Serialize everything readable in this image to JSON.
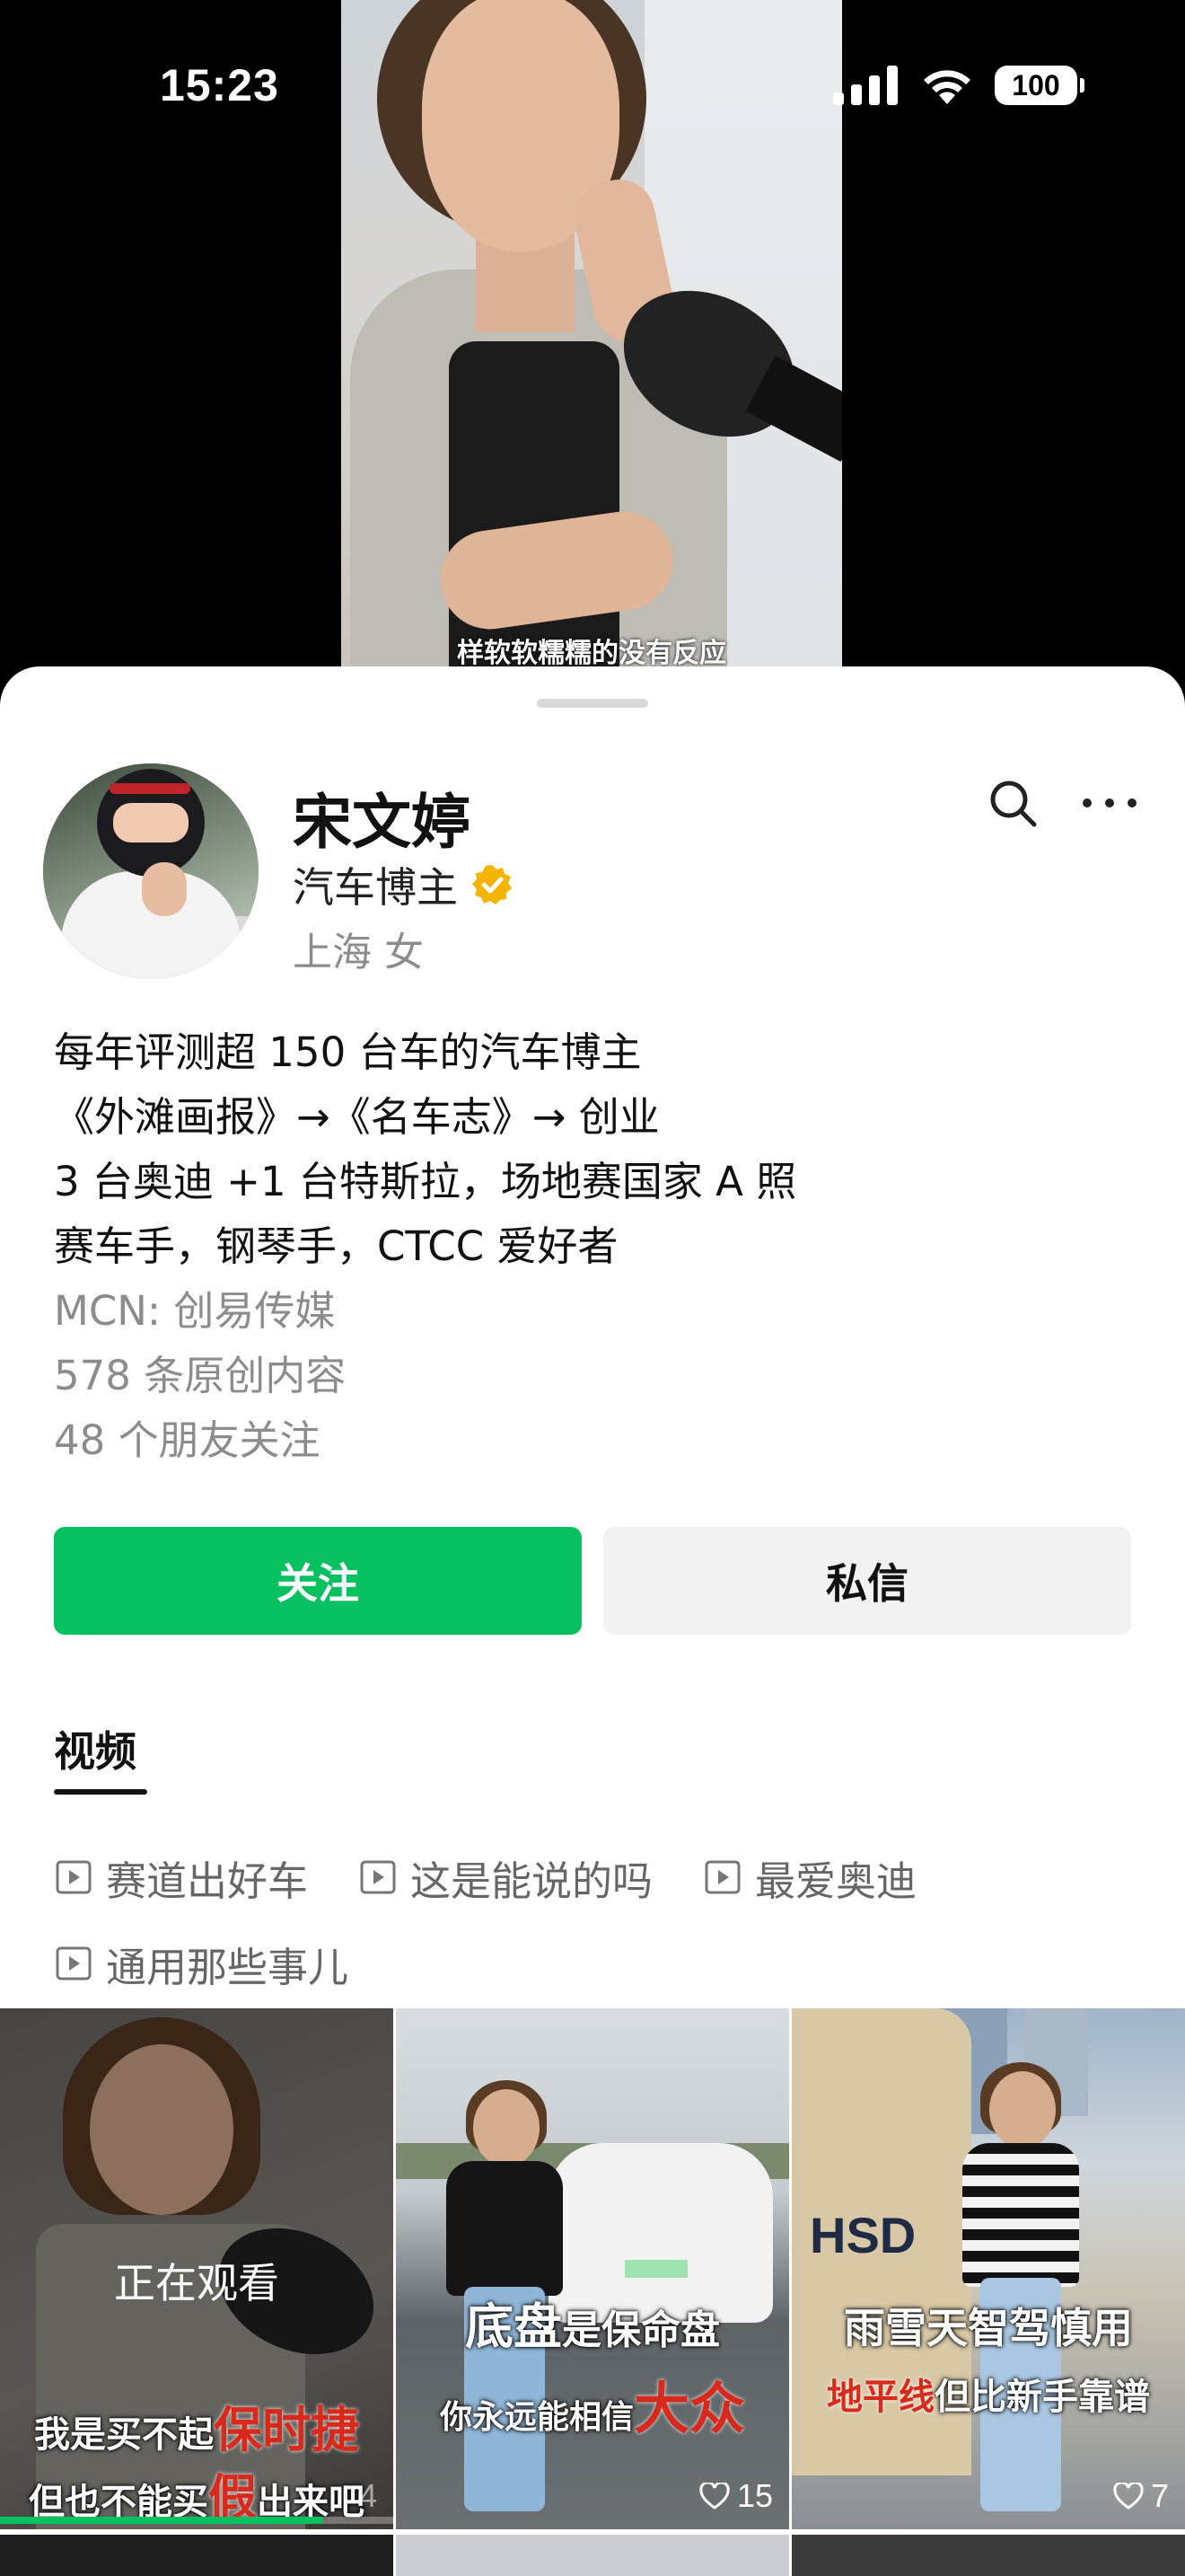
{
  "status_bar": {
    "time": "15:23",
    "battery": "100"
  },
  "video": {
    "caption": "样软软糯糯的没有反应"
  },
  "profile": {
    "name": "宋文婷",
    "role": "汽车博主",
    "location": "上海 女",
    "bio": [
      "每年评测超 150 台车的汽车博主",
      "《外滩画报》→《名车志》→ 创业",
      "3 台奥迪 +1 台特斯拉，场地赛国家 A 照",
      "赛车手，钢琴手，CTCC 爱好者"
    ],
    "mcn": "MCN: 创易传媒",
    "original_count": "578 条原创内容",
    "friends_following": "48 个朋友关注"
  },
  "actions": {
    "follow": "关注",
    "message": "私信"
  },
  "tabs": {
    "videos": "视频"
  },
  "collections": [
    "赛道出好车",
    "这是能说的吗",
    "最爱奥迪",
    "通用那些事儿"
  ],
  "videos": [
    {
      "overlay": "正在观看",
      "caption_top_white": "我是买不起",
      "caption_top_red": "保时捷",
      "caption_bottom_white_1": "但也不能买",
      "caption_bottom_red": "假",
      "caption_bottom_white_2": "出来吧",
      "likes": "4",
      "progress": 0.82
    },
    {
      "caption_top_white": "底盘",
      "caption_top_white_2": "是保命盘",
      "caption_bottom_white": "你永远能相信",
      "caption_bottom_red": "大众",
      "likes": "15"
    },
    {
      "caption_top_white": "雨雪天智驾慎用",
      "caption_bottom_red": "地平线",
      "caption_bottom_white": "但比新手靠谱",
      "likes": "7"
    }
  ],
  "colors": {
    "accent_green": "#07c160",
    "verified_gold": "#f5b400",
    "caption_red": "#d82a1c"
  },
  "icons": [
    "search-icon",
    "more-icon",
    "verified-icon",
    "video-collection-icon",
    "heart-icon",
    "signal-icon",
    "wifi-icon",
    "battery-icon"
  ]
}
